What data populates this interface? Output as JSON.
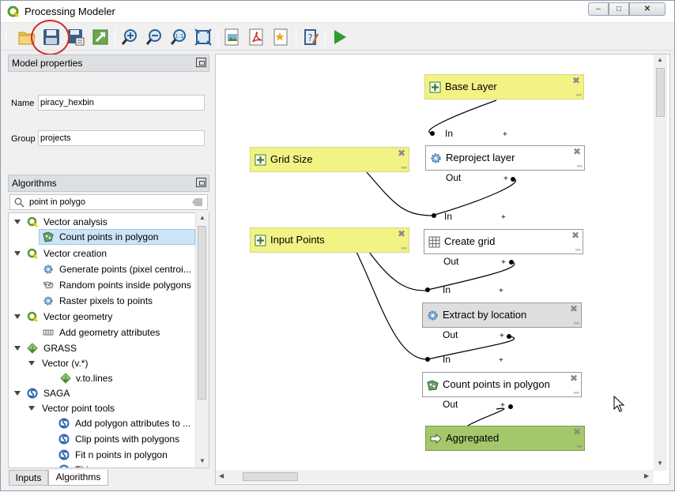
{
  "window": {
    "title": "Processing Modeler",
    "min": "–",
    "max": "□",
    "close": "✕"
  },
  "toolbar": {
    "buttons": [
      "open-model",
      "save-model",
      "save-as",
      "export-python",
      "zoom-in",
      "zoom-out",
      "zoom-actual",
      "zoom-full",
      "export-image",
      "export-pdf",
      "export-svg",
      "edit-help",
      "run-model"
    ]
  },
  "model_properties": {
    "header": "Model properties",
    "name_label": "Name",
    "name_value": "piracy_hexbin",
    "group_label": "Group",
    "group_value": "projects"
  },
  "algorithms": {
    "header": "Algorithms",
    "search_value": "point in polygo",
    "tree": [
      "Vector analysis",
      "Count points in polygon",
      "Vector creation",
      "Generate points (pixel centroi...",
      "Random points inside polygons",
      "Raster pixels to points",
      "Vector geometry",
      "Add geometry attributes",
      "GRASS",
      "Vector (v.*)",
      "v.to.lines",
      "SAGA",
      "Vector point tools",
      "Add polygon attributes to ...",
      "Clip points with polygons",
      "Fit n points in polygon",
      "Thi..."
    ]
  },
  "tabs": {
    "inputs": "Inputs",
    "algorithms": "Algorithms"
  },
  "canvas": {
    "nodes": {
      "base_layer": "Base Layer",
      "grid_size": "Grid Size",
      "input_points": "Input Points",
      "reproject": "Reproject layer",
      "create_grid": "Create grid",
      "extract": "Extract by location",
      "count": "Count points in polygon",
      "aggregated": "Aggregated"
    },
    "port_in": "In",
    "port_out": "Out",
    "plus": "+",
    "close_glyph": "✖",
    "dots": "◦◦◦"
  },
  "colors": {
    "input": "#f2f285",
    "output": "#a4c76b",
    "run": "#2e9a32",
    "highlight": "#d22a2a"
  }
}
